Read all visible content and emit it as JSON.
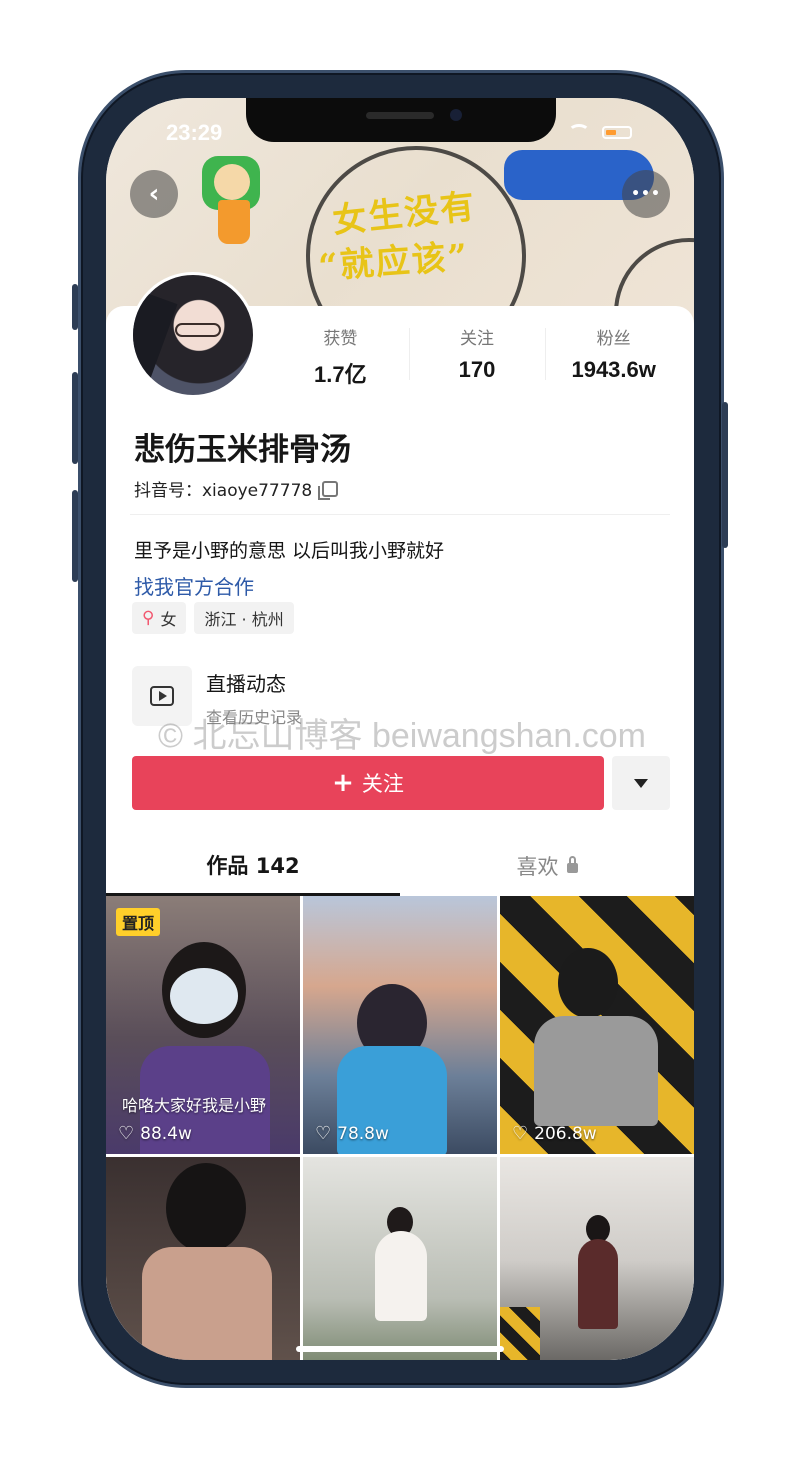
{
  "status": {
    "time": "23:29"
  },
  "header": {
    "back_icon": "‹",
    "more_icon": "•••"
  },
  "banner": {
    "text_line1": "女生没有",
    "text_line2": "“就应该”"
  },
  "profile": {
    "stats": [
      {
        "label": "获赞",
        "value": "1.7亿"
      },
      {
        "label": "关注",
        "value": "170"
      },
      {
        "label": "粉丝",
        "value": "1943.6w"
      }
    ],
    "nickname": "悲伤玉米排骨汤",
    "douyin_id": "抖音号：xiaoye77778",
    "bio": "里予是小野的意思 以后叫我小野就好",
    "cooperation_link": "找我官方合作",
    "tags": {
      "gender": "女",
      "location": "浙江 · 杭州"
    }
  },
  "live": {
    "title": "直播动态",
    "subtitle": "查看历史记录"
  },
  "watermark": "© 北忘山博客 beiwangshan.com",
  "actions": {
    "follow_label": "关注"
  },
  "tabs": {
    "works": "作品 142",
    "likes": "喜欢"
  },
  "videos": [
    {
      "badge": "置顶",
      "caption": "哈咯大家好我是小野",
      "likes": "88.4w"
    },
    {
      "likes": "78.8w"
    },
    {
      "likes": "206.8w"
    },
    {},
    {},
    {}
  ],
  "colors": {
    "accent": "#e8435a",
    "link": "#2e5aa8",
    "pin_badge": "#ffcf2a"
  }
}
